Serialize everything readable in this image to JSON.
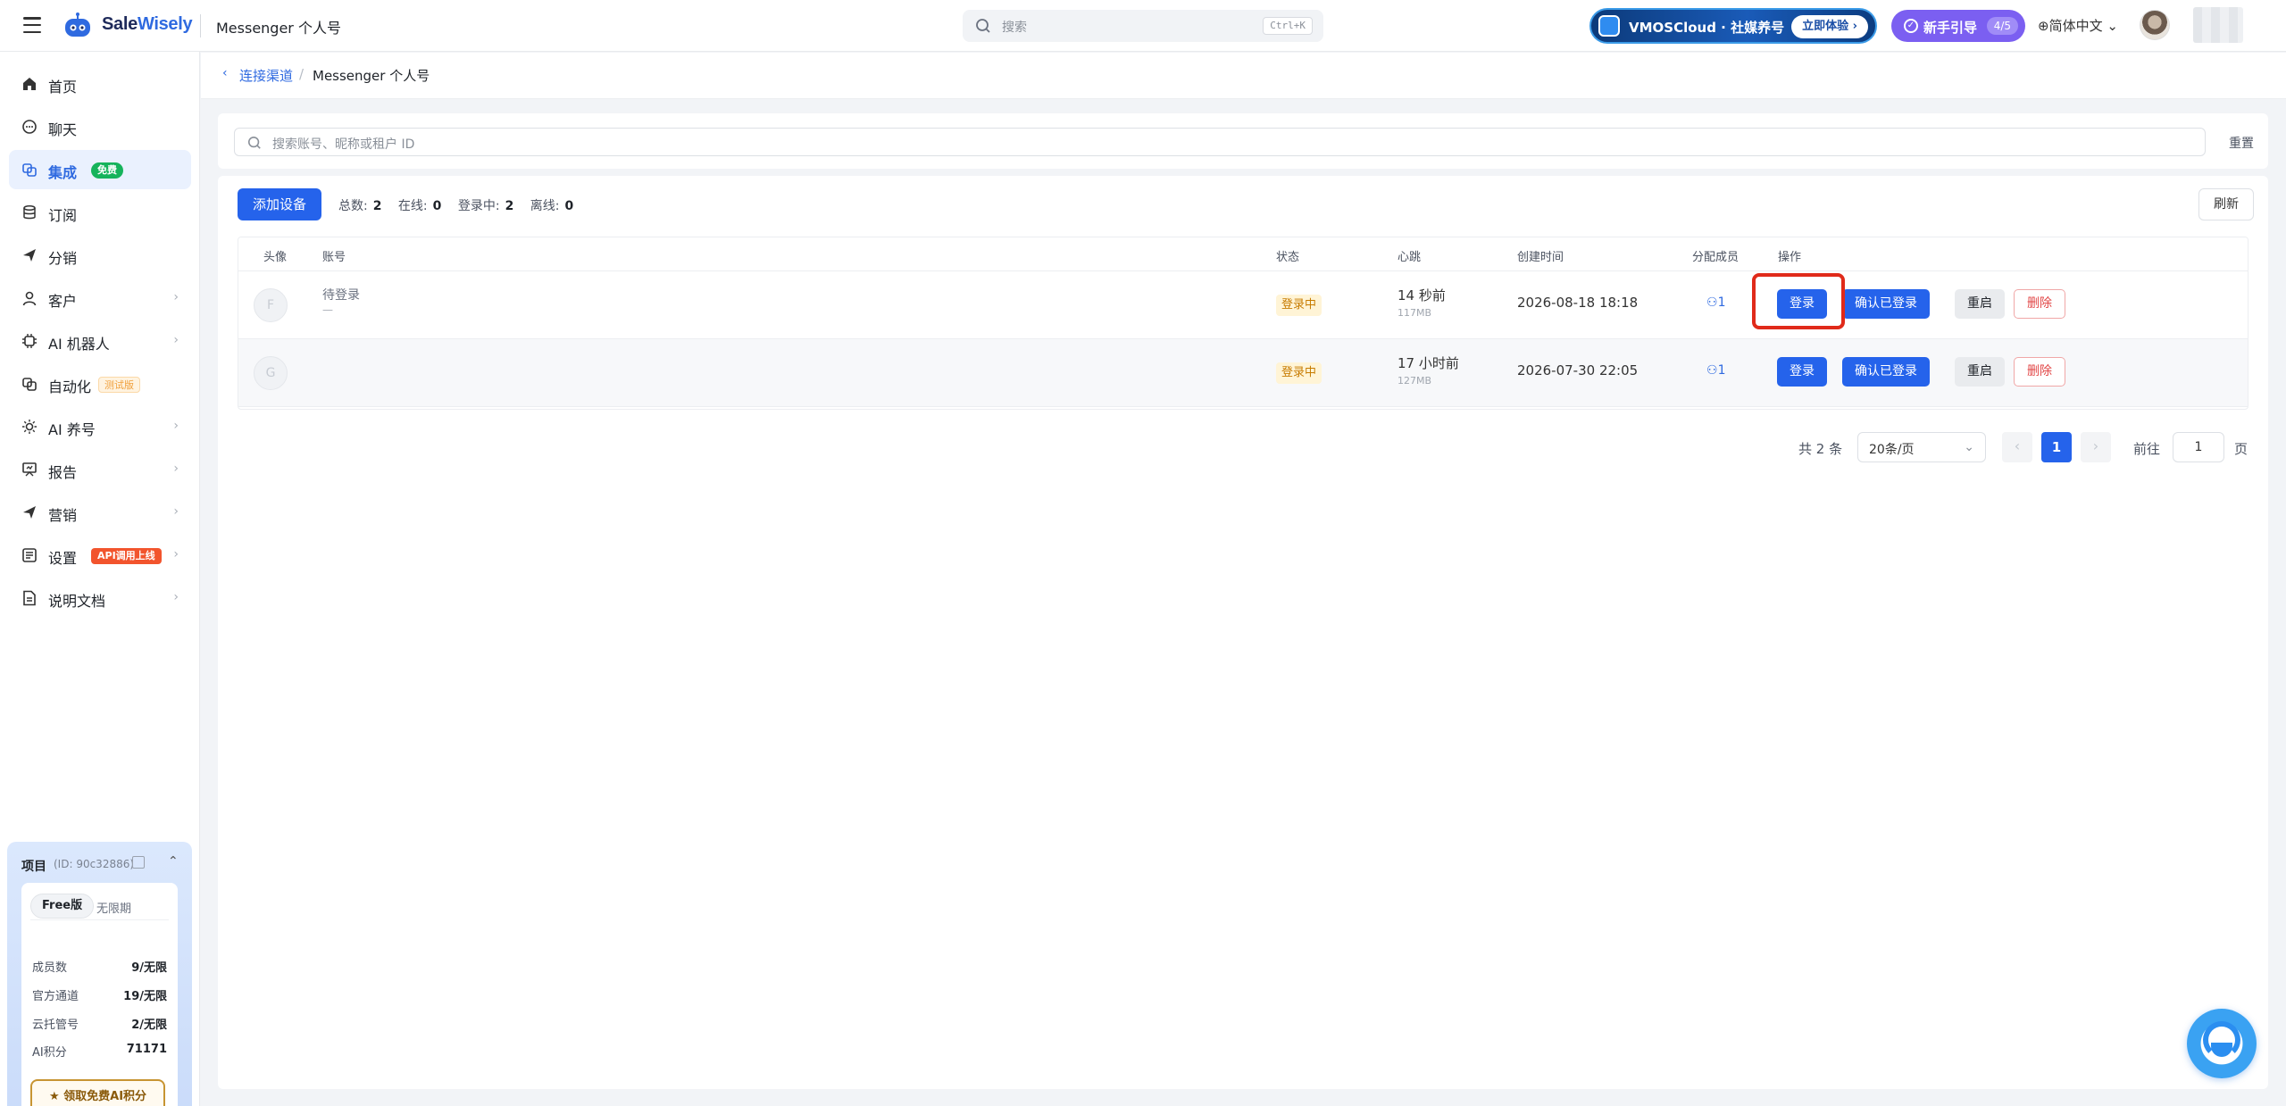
{
  "header": {
    "brand_part1": "Sale",
    "brand_part2": "Wisely",
    "page_name": "Messenger 个人号",
    "search_placeholder": "搜索",
    "search_shortcut": "Ctrl+K",
    "promo_text": "VMOSCloud · 社媒养号",
    "promo_button": "立即体验",
    "guide_label": "新手引导",
    "guide_progress": "4/5",
    "language": "简体中文"
  },
  "sidebar": {
    "items": [
      {
        "label": "首页",
        "icon": "home-icon"
      },
      {
        "label": "聊天",
        "icon": "chat-icon"
      },
      {
        "label": "集成",
        "icon": "integration-icon",
        "badge": "免费",
        "active": true
      },
      {
        "label": "订阅",
        "icon": "database-icon"
      },
      {
        "label": "分销",
        "icon": "send-icon"
      },
      {
        "label": "客户",
        "icon": "user-icon"
      },
      {
        "label": "AI 机器人",
        "icon": "chip-icon"
      },
      {
        "label": "自动化",
        "icon": "automation-icon",
        "badge": "测试版"
      },
      {
        "label": "AI 养号",
        "icon": "sun-icon"
      },
      {
        "label": "报告",
        "icon": "report-icon"
      },
      {
        "label": "营销",
        "icon": "send-icon"
      },
      {
        "label": "设置",
        "icon": "settings-icon",
        "badge": "API调用上线"
      },
      {
        "label": "说明文档",
        "icon": "doc-icon"
      }
    ],
    "chevron": "›"
  },
  "project": {
    "title": "项目",
    "id_text": "(ID: 90c32886)",
    "plan": "Free版",
    "period": "无限期",
    "rows": [
      {
        "key": "成员数",
        "value": "9/无限"
      },
      {
        "key": "官方通道",
        "value": "19/无限"
      },
      {
        "key": "云托管号",
        "value": "2/无限"
      },
      {
        "key": "AI积分",
        "value": "71171"
      }
    ],
    "claim_button": "领取免费AI积分"
  },
  "breadcrumb": {
    "back": "‹",
    "parent": "连接渠道",
    "separator": "/",
    "current": "Messenger 个人号"
  },
  "filter": {
    "placeholder": "搜索账号、昵称或租户 ID",
    "reset": "重置"
  },
  "toolbar": {
    "add_device": "添加设备",
    "total_label": "总数:",
    "total": "2",
    "online_label": "在线:",
    "online": "0",
    "logging_label": "登录中:",
    "logging": "2",
    "offline_label": "离线:",
    "offline": "0",
    "refresh": "刷新"
  },
  "table": {
    "columns": [
      "头像",
      "账号",
      "状态",
      "心跳",
      "创建时间",
      "分配成员",
      "操作"
    ],
    "rows": [
      {
        "avatar": "F",
        "account": "待登录",
        "account_sub": "—",
        "status": "登录中",
        "heartbeat": "14 秒前",
        "memory": "117MB",
        "created": "2026-08-18 18:18",
        "members": "1"
      },
      {
        "avatar": "G",
        "account": "",
        "account_sub": "",
        "status": "登录中",
        "heartbeat": "17 小时前",
        "memory": "127MB",
        "created": "2026-07-30 22:05",
        "members": "1"
      }
    ],
    "actions": {
      "login": "登录",
      "confirm": "确认已登录",
      "restart": "重启",
      "delete": "删除"
    }
  },
  "pagination": {
    "total_text": "共 2 条",
    "page_size": "20条/页",
    "prev": "‹",
    "current_page": "1",
    "next": "›",
    "goto_label": "前往",
    "goto_value": "1",
    "goto_unit": "页"
  },
  "colors": {
    "accent": "#2563eb",
    "highlight_box": "#e02a1a",
    "status_warning": "#c77b00",
    "danger": "#e24747"
  }
}
